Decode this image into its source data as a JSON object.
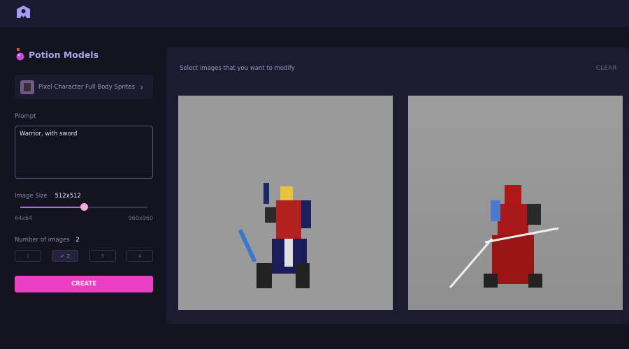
{
  "app": {
    "logo_icon": "ghost-logo-icon"
  },
  "sidebar": {
    "title": "Potion Models",
    "title_icon": "potion-icon",
    "model": {
      "label": "Pixel Character Full Body Sprites",
      "icon": "chevron-right-icon",
      "chevron": "›"
    },
    "prompt": {
      "label": "Prompt",
      "value": "Warrior, with sword"
    },
    "image_size": {
      "label": "Image Size",
      "value": "512x512",
      "min": "64x64",
      "max": "960x960",
      "fraction": 0.5
    },
    "num_images": {
      "label": "Number of images",
      "value": "2",
      "options": [
        "1",
        "2",
        "3",
        "4"
      ],
      "selected": "2",
      "check": "✔"
    },
    "create_label": "CREATE"
  },
  "main": {
    "hint": "Select images that you want to modify",
    "clear_label": "CLEAR"
  },
  "colors": {
    "accent": "#ea3fc4",
    "slider": "#b46ad8",
    "background": "#141320",
    "panel": "#1d1b30"
  }
}
